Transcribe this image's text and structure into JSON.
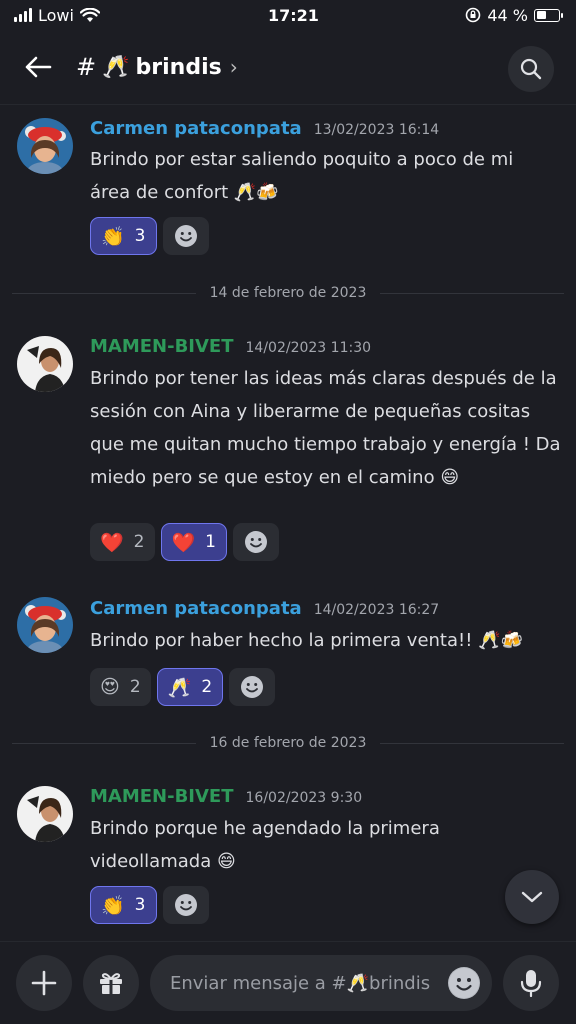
{
  "status_bar": {
    "carrier": "Lowi",
    "time": "17:21",
    "battery": "44 %",
    "battery_level": 0.44
  },
  "header": {
    "channel_emoji": "🥂",
    "channel_name": "brindis",
    "chevron": "›"
  },
  "dividers": [
    "14 de febrero de 2023",
    "16 de febrero de 2023"
  ],
  "messages": [
    {
      "author": "Carmen pataconpata",
      "timestamp": "13/02/2023 16:14",
      "text": "Brindo por estar saliendo poquito a poco de mi área de confort 🥂🍻",
      "reactions": [
        {
          "emoji": "👏",
          "count": "3",
          "active": true
        }
      ]
    },
    {
      "author": "MAMEN-BIVET",
      "timestamp": "14/02/2023 11:30",
      "text": "Brindo por tener las ideas más claras después de la sesión con Aina y liberarme de pequeñas cositas que me quitan mucho tiempo trabajo y energía ! Da miedo pero se que estoy en el camino 😄",
      "reactions": [
        {
          "emoji": "❤️",
          "count": "2",
          "active": false
        },
        {
          "emoji": "❤️",
          "count": "1",
          "active": true
        }
      ]
    },
    {
      "author": "Carmen pataconpata",
      "timestamp": "14/02/2023 16:27",
      "text": "Brindo por haber hecho la primera venta!! 🥂🍻",
      "reactions": [
        {
          "emoji": "😍",
          "count": "2",
          "active": false
        },
        {
          "emoji": "🥂",
          "count": "2",
          "active": true
        }
      ]
    },
    {
      "author": "MAMEN-BIVET",
      "timestamp": "16/02/2023 9:30",
      "text": "Brindo porque he agendado la primera videollamada 😄",
      "reactions": [
        {
          "emoji": "👏",
          "count": "3",
          "active": true
        }
      ]
    }
  ],
  "composer": {
    "placeholder": "Enviar mensaje a #🥂brindis"
  },
  "colors": {
    "background": "#1c1d23",
    "author_blue": "#3ba0dd",
    "author_green": "#2e9a5a",
    "reaction_active": "#3c3f8f"
  }
}
